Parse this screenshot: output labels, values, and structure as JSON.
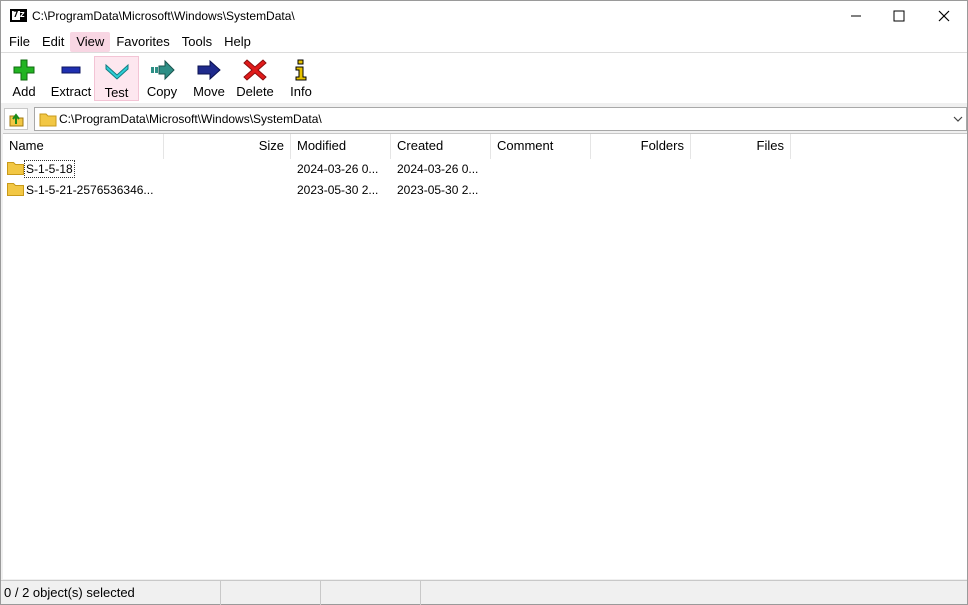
{
  "window": {
    "title": "C:\\ProgramData\\Microsoft\\Windows\\SystemData\\",
    "app_icon_text": "7z",
    "controls": [
      "minimize-icon",
      "maximize-icon",
      "close-icon"
    ]
  },
  "menu": {
    "items": [
      {
        "label": "File"
      },
      {
        "label": "Edit"
      },
      {
        "label": "View",
        "active": true
      },
      {
        "label": "Favorites"
      },
      {
        "label": "Tools"
      },
      {
        "label": "Help"
      }
    ]
  },
  "toolbar": {
    "buttons": [
      {
        "label": "Add",
        "icon": "plus-icon",
        "color": "#1aa31a"
      },
      {
        "label": "Extract",
        "icon": "minus-icon",
        "color": "#1f2fb0"
      },
      {
        "label": "Test",
        "icon": "check-icon",
        "color": "#24c3c8",
        "active": true
      },
      {
        "label": "Copy",
        "icon": "copy-arrow-icon",
        "color": "#2e8f86"
      },
      {
        "label": "Move",
        "icon": "move-arrow-icon",
        "color": "#1f2a8c"
      },
      {
        "label": "Delete",
        "icon": "delete-x-icon",
        "color": "#e01b1b"
      },
      {
        "label": "Info",
        "icon": "info-icon",
        "color": "#e6c200"
      }
    ]
  },
  "address": {
    "value": "C:\\ProgramData\\Microsoft\\Windows\\SystemData\\"
  },
  "list": {
    "columns": [
      "Name",
      "Size",
      "Modified",
      "Created",
      "Comment",
      "Folders",
      "Files"
    ],
    "rows": [
      {
        "name": "S-1-5-18",
        "size": "",
        "modified": "2024-03-26 0...",
        "created": "2024-03-26 0...",
        "comment": "",
        "folders": "",
        "files": "",
        "focused": true
      },
      {
        "name": "S-1-5-21-2576536346...",
        "size": "",
        "modified": "2023-05-30 2...",
        "created": "2023-05-30 2...",
        "comment": "",
        "folders": "",
        "files": ""
      }
    ]
  },
  "status": {
    "selection": "0 / 2 object(s) selected",
    "cell2": "",
    "cell3": ""
  },
  "colors": {
    "menu_active": "#f8d6e3",
    "folder": "#f2c744"
  }
}
